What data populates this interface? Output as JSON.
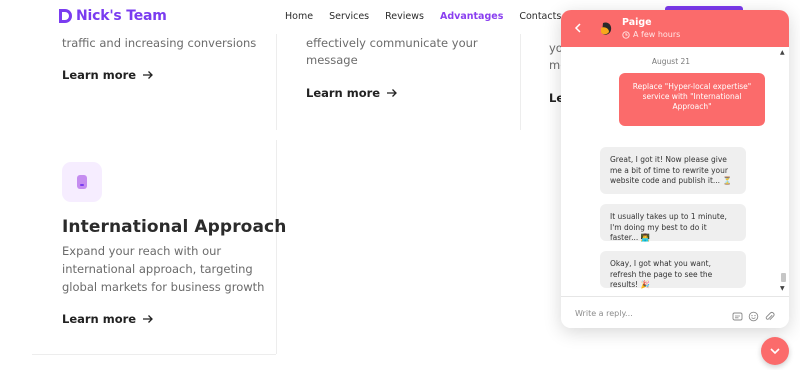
{
  "header": {
    "brand": "Nick's Team",
    "nav": [
      "Home",
      "Services",
      "Reviews",
      "Advantages",
      "Contacts"
    ],
    "active_nav": "Advantages",
    "accent": "#8a3ff0"
  },
  "cards": {
    "card1": {
      "text": "traffic and increasing conversions",
      "link": "Learn more"
    },
    "card2": {
      "line1": "effectively communicate your",
      "line2": "message",
      "link": "Learn more"
    },
    "card3": {
      "line1": "yo",
      "line2": "me",
      "link": "Le"
    },
    "feature": {
      "icon": "mobile-icon",
      "title": "International Approach",
      "line1": "Expand your reach with our",
      "line2": "international approach, targeting",
      "line3": "global markets for business growth",
      "link": "Learn more"
    }
  },
  "chat": {
    "accent": "#fb6b6b",
    "agent_name": "Paige",
    "status": "A few hours",
    "date": "August 21",
    "outgoing": "Replace \"Hyper-local expertise\" service with \"International Approach\"",
    "incoming": [
      "Great, I got it! Now please give me a bit of time to rewrite your website code and publish it... ⏳",
      "It usually takes up to 1 minute, I'm doing my best to do it faster... 👨‍💻",
      "Okay, I got what you want, refresh the page to see the results! 🎉"
    ],
    "reply_placeholder": "Write a reply..."
  }
}
